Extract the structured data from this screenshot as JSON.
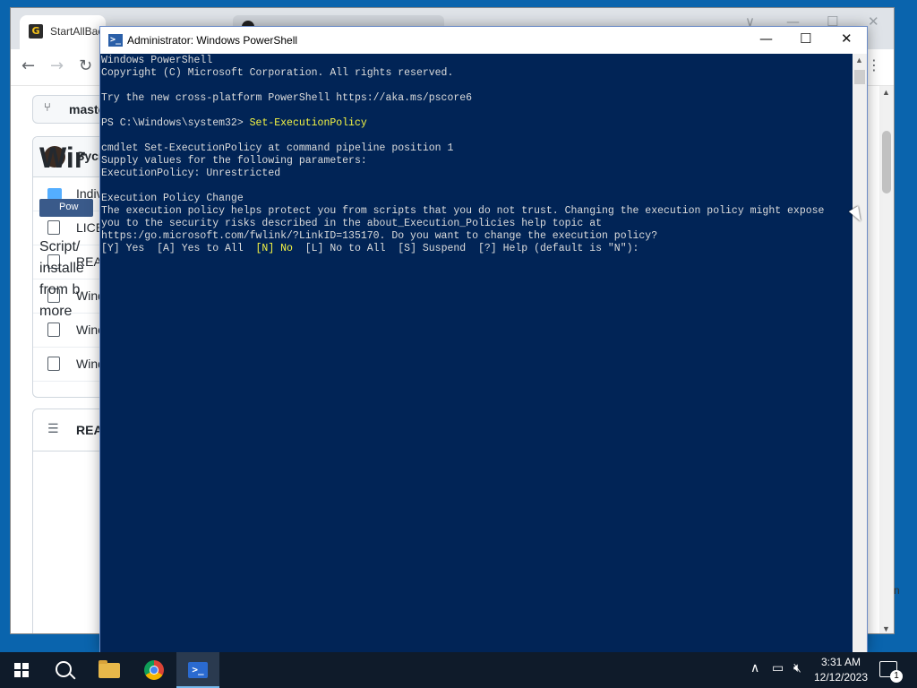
{
  "browser": {
    "tab_title": "StartAllBack",
    "tab_icon": "G",
    "window_controls": [
      "∨",
      "—",
      "☐",
      "✕"
    ],
    "nav": {
      "back": "←",
      "forward": "→",
      "reload": "↻",
      "menu": "⋮"
    },
    "branch_label": "master",
    "repo_owner": "Sycn",
    "files": [
      {
        "name": "Indiv",
        "type": "folder"
      },
      {
        "name": "LICE",
        "type": "file"
      },
      {
        "name": "REA",
        "type": "file"
      },
      {
        "name": "Wind",
        "type": "file"
      },
      {
        "name": "Winc",
        "type": "file"
      },
      {
        "name": "Wind",
        "type": "file"
      }
    ],
    "readme_label": "README",
    "readme_title": "Wir",
    "badge_label": "Pow",
    "readme_text": [
      "Script/",
      "installe",
      "from b",
      "more"
    ],
    "edge_letter": "n"
  },
  "powershell": {
    "title": "Administrator: Windows PowerShell",
    "icon": ">_",
    "controls": {
      "minimize": "—",
      "maximize": "☐",
      "close": "✕"
    },
    "console_lines": {
      "l1": "Windows PowerShell",
      "l2": "Copyright (C) Microsoft Corporation. All rights reserved.",
      "l3": "Try the new cross-platform PowerShell https://aka.ms/pscore6",
      "l4_prompt": "PS C:\\Windows\\system32> ",
      "l4_cmd": "Set-ExecutionPolicy",
      "l5": "cmdlet Set-ExecutionPolicy at command pipeline position 1",
      "l6": "Supply values for the following parameters:",
      "l7": "ExecutionPolicy: Unrestricted",
      "l8": "Execution Policy Change",
      "l9": "The execution policy helps protect you from scripts that you do not trust. Changing the execution policy might expose",
      "l10": "you to the security risks described in the about_Execution_Policies help topic at",
      "l11": "https:/go.microsoft.com/fwlink/?LinkID=135170. Do you want to change the execution policy?",
      "l12_a": "[Y] Yes  [A] Yes to All  ",
      "l12_b": "[N] No",
      "l12_c": "  [L] No to All  [S] Suspend  [?] Help (default is \"N\"):"
    }
  },
  "taskbar": {
    "time": "3:31 AM",
    "date": "12/12/2023",
    "notification_count": "1",
    "pinned": [
      "start",
      "search",
      "file-explorer",
      "chrome",
      "powershell"
    ],
    "active_app": "powershell",
    "tray_icons": [
      "chevron-up-icon",
      "network-icon",
      "volume-muted-icon"
    ]
  }
}
